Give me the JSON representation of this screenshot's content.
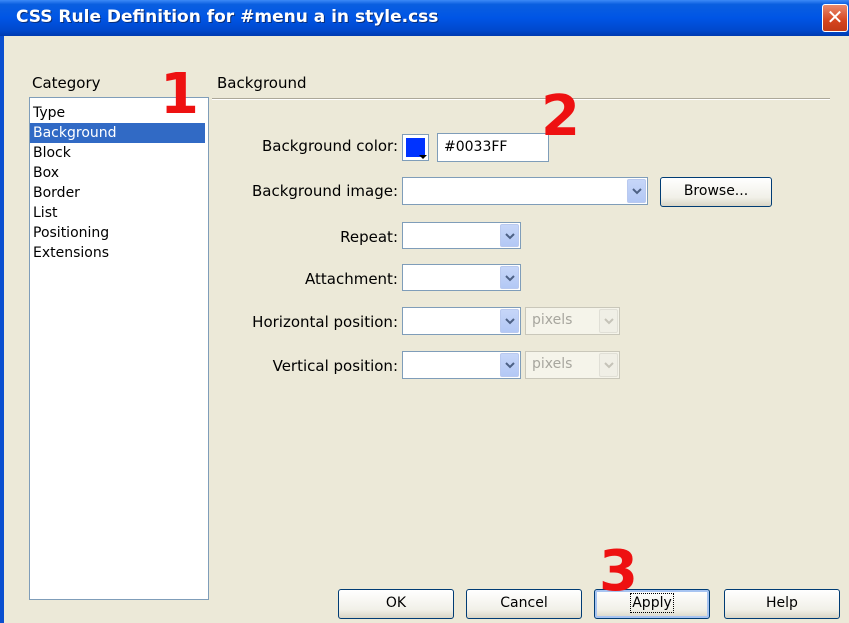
{
  "window": {
    "title": "CSS Rule Definition for #menu a in style.css",
    "close_glyph": "✕"
  },
  "category": {
    "header": "Category",
    "items": [
      "Type",
      "Background",
      "Block",
      "Box",
      "Border",
      "List",
      "Positioning",
      "Extensions"
    ],
    "selected": "Background"
  },
  "panel": {
    "title": "Background",
    "background_color": {
      "label": "Background color:",
      "value": "#0033FF",
      "swatch_color": "#0033FF"
    },
    "background_image": {
      "label": "Background image:",
      "value": ""
    },
    "browse_label": "Browse...",
    "repeat": {
      "label": "Repeat:",
      "value": ""
    },
    "attachment": {
      "label": "Attachment:",
      "value": ""
    },
    "horizontal_position": {
      "label": "Horizontal position:",
      "value": "",
      "unit": "pixels"
    },
    "vertical_position": {
      "label": "Vertical position:",
      "value": "",
      "unit": "pixels"
    }
  },
  "buttons": {
    "ok": "OK",
    "cancel": "Cancel",
    "apply": "Apply",
    "help": "Help"
  },
  "annotations": {
    "one": "1",
    "two": "2",
    "three": "3",
    "color": "#ee1111"
  }
}
